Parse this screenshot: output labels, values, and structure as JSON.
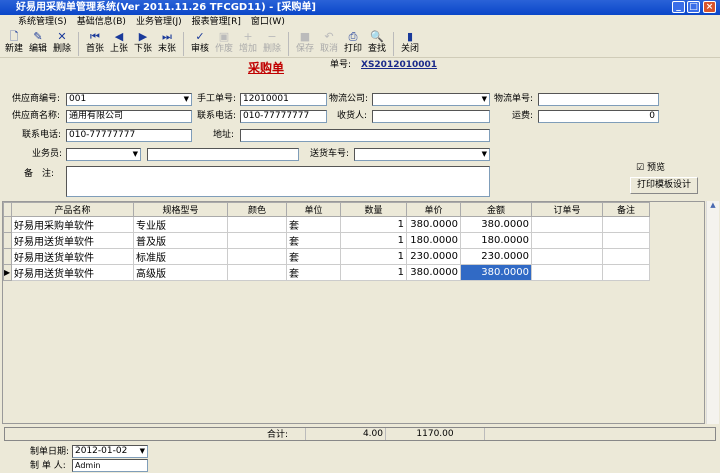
{
  "window": {
    "title": "好易用采购单管理系统(Ver 2011.11.26 TFCGD11) - [采购单]"
  },
  "menu": [
    "系统管理(S)",
    "基础信息(B)",
    "业务管理(J)",
    "报表管理[R]",
    "窗口(W)"
  ],
  "toolbar": [
    {
      "label": "新建",
      "icon": "new-doc-icon",
      "glyph": "🗋",
      "enabled": true
    },
    {
      "label": "编辑",
      "icon": "edit-icon",
      "glyph": "✎",
      "enabled": true
    },
    {
      "label": "删除",
      "icon": "delete-icon",
      "glyph": "✕",
      "enabled": true
    },
    {
      "sep": true
    },
    {
      "label": "首张",
      "icon": "first-icon",
      "glyph": "⏮",
      "enabled": true
    },
    {
      "label": "上张",
      "icon": "prev-icon",
      "glyph": "◀",
      "enabled": true
    },
    {
      "label": "下张",
      "icon": "next-icon",
      "glyph": "▶",
      "enabled": true
    },
    {
      "label": "末张",
      "icon": "last-icon",
      "glyph": "⏭",
      "enabled": true
    },
    {
      "sep": true
    },
    {
      "label": "审核",
      "icon": "approve-icon",
      "glyph": "✓",
      "enabled": true
    },
    {
      "label": "作废",
      "icon": "void-icon",
      "glyph": "▣",
      "enabled": false
    },
    {
      "label": "增加",
      "icon": "add-icon",
      "glyph": "+",
      "enabled": false
    },
    {
      "label": "删除",
      "icon": "remove-icon",
      "glyph": "−",
      "enabled": false
    },
    {
      "sep": true
    },
    {
      "label": "保存",
      "icon": "save-icon",
      "glyph": "■",
      "enabled": false
    },
    {
      "label": "取消",
      "icon": "undo-icon",
      "glyph": "↶",
      "enabled": false
    },
    {
      "label": "打印",
      "icon": "print-icon",
      "glyph": "⎙",
      "enabled": true
    },
    {
      "label": "查找",
      "icon": "find-icon",
      "glyph": "🔍",
      "enabled": true
    },
    {
      "sep": true
    },
    {
      "label": "关闭",
      "icon": "close-door-icon",
      "glyph": "▮",
      "enabled": true
    }
  ],
  "form": {
    "title": "采购单",
    "order_no_label": "单号:",
    "order_no": "XS2012010001",
    "supplier_code_label": "供应商编号:",
    "supplier_code": "001",
    "manual_no_label": "手工单号:",
    "manual_no": "12010001",
    "logistics_co_label": "物流公司:",
    "logistics_co": "",
    "logistics_no_label": "物流单号:",
    "logistics_no": "",
    "supplier_name_label": "供应商名称:",
    "supplier_name": "通用有限公司",
    "contact_phone_label": "联系电话:",
    "contact_phone": "010-77777777",
    "receiver_label": "收货人:",
    "receiver": "",
    "freight_label": "运费:",
    "freight": "0",
    "phone_label": "联系电话:",
    "phone": "010-77777777",
    "address_label": "地址:",
    "address": "",
    "salesman_label": "业务员:",
    "salesman": "",
    "salesman_name": "",
    "truck_no_label": "送货车号:",
    "truck_no": "",
    "remark_label": "备　注:",
    "remark": "",
    "preview_label": "预览",
    "preview_checked": true,
    "print_design_button": "打印模板设计"
  },
  "grid": {
    "columns": [
      "产品名称",
      "规格型号",
      "颜色",
      "单位",
      "数量",
      "单价",
      "金额",
      "订单号",
      "备注"
    ],
    "rows": [
      [
        "好易用采购单软件",
        "专业版",
        "",
        "套",
        "1",
        "380.0000",
        "380.0000",
        "",
        ""
      ],
      [
        "好易用送货单软件",
        "普及版",
        "",
        "套",
        "1",
        "180.0000",
        "180.0000",
        "",
        ""
      ],
      [
        "好易用送货单软件",
        "标准版",
        "",
        "套",
        "1",
        "230.0000",
        "230.0000",
        "",
        ""
      ],
      [
        "好易用送货单软件",
        "高级版",
        "",
        "套",
        "1",
        "380.0000",
        "380.0000",
        "",
        ""
      ]
    ],
    "current_row": 3
  },
  "totals": {
    "label": "合计:",
    "qty": "4.00",
    "amount": "1170.00"
  },
  "footer": {
    "date_label": "制单日期:",
    "date": "2012-01-02",
    "maker_label": "制 单 人:",
    "maker": "Admin"
  }
}
